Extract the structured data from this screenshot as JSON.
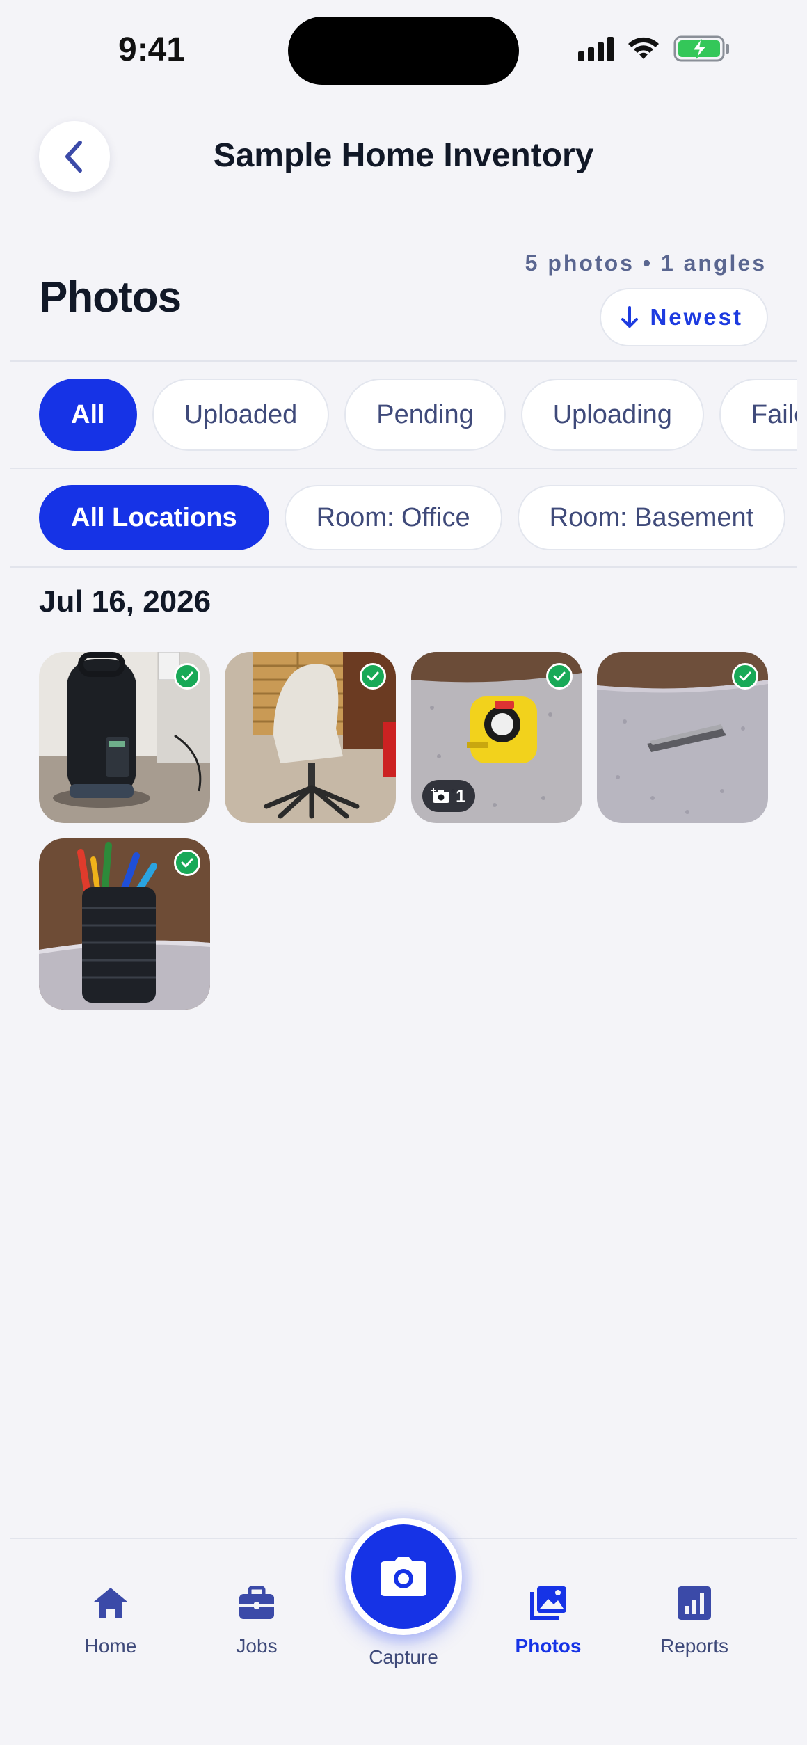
{
  "status_bar": {
    "time": "9:41"
  },
  "header": {
    "title": "Sample Home Inventory",
    "back_icon": "chevron-left-icon"
  },
  "page": {
    "title": "Photos",
    "stats": "5 photos • 1 angles",
    "sort_label": "Newest",
    "sort_icon": "arrow-down-icon"
  },
  "status_filters": [
    {
      "label": "All",
      "active": true
    },
    {
      "label": "Uploaded",
      "active": false
    },
    {
      "label": "Pending",
      "active": false
    },
    {
      "label": "Uploading",
      "active": false
    },
    {
      "label": "Failed",
      "active": false
    }
  ],
  "location_filters": [
    {
      "label": "All Locations",
      "active": true
    },
    {
      "label": "Room: Office",
      "active": false
    },
    {
      "label": "Room: Basement",
      "active": false
    }
  ],
  "groups": [
    {
      "date": "Jul 16, 2026",
      "photos": [
        {
          "subject": "space heater",
          "uploaded": true
        },
        {
          "subject": "office chair",
          "uploaded": true
        },
        {
          "subject": "tape measure",
          "uploaded": true,
          "angles": "1"
        },
        {
          "subject": "nail clipper",
          "uploaded": true
        },
        {
          "subject": "pen holder",
          "uploaded": true
        }
      ]
    }
  ],
  "tab_bar": {
    "items": [
      {
        "label": "Home",
        "icon": "home-icon",
        "active": false
      },
      {
        "label": "Jobs",
        "icon": "briefcase-icon",
        "active": false
      },
      {
        "label": "Capture",
        "icon": "camera-icon",
        "active": false
      },
      {
        "label": "Photos",
        "icon": "photos-icon",
        "active": true
      },
      {
        "label": "Reports",
        "icon": "chart-icon",
        "active": false
      }
    ]
  },
  "colors": {
    "accent": "#1633e6",
    "success": "#18a957",
    "background": "#f4f4f8"
  }
}
